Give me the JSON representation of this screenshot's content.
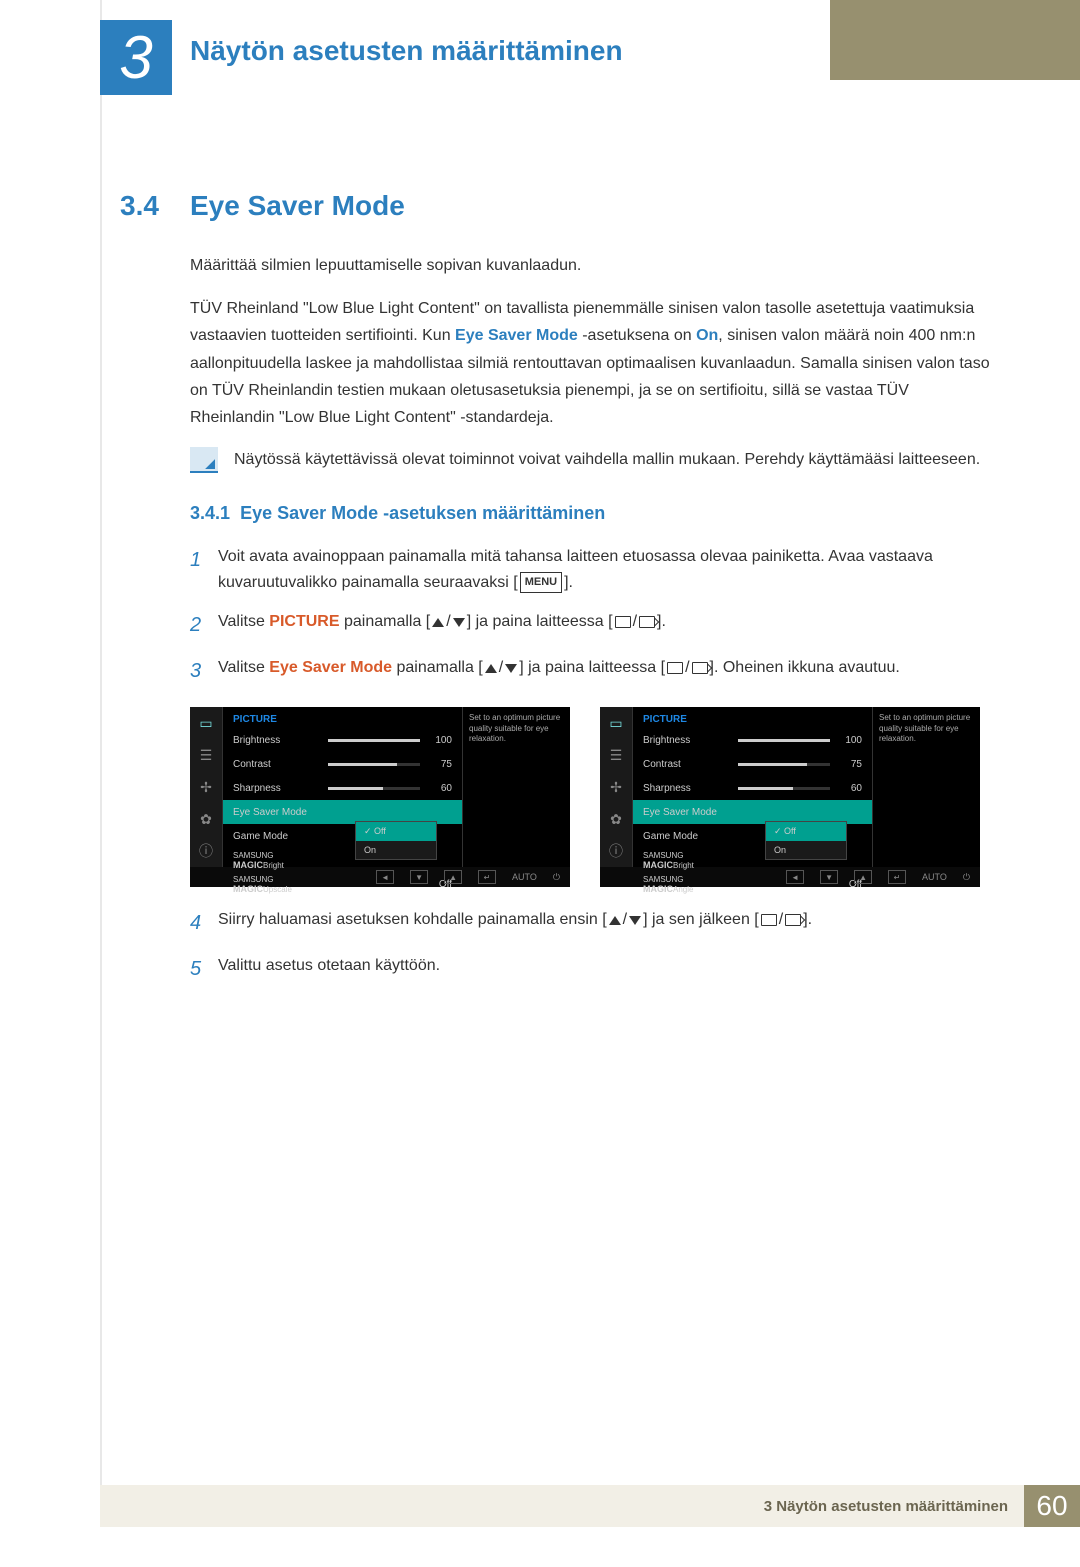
{
  "chapter": {
    "num": "3",
    "title": "Näytön asetusten määrittäminen"
  },
  "sec": {
    "num": "3.4",
    "title": "Eye Saver Mode"
  },
  "intro1": "Määrittää silmien lepuuttamiselle sopivan kuvanlaadun.",
  "intro2a": "TÜV Rheinland \"Low Blue Light Content\" on tavallista pienemmälle sinisen valon tasolle asetettuja vaatimuksia vastaavien tuotteiden sertifiointi. Kun ",
  "intro2b": "Eye Saver Mode",
  "intro2c": " -asetuksena on ",
  "intro2d": "On",
  "intro2e": ", sinisen valon määrä noin 400 nm:n aallonpituudella laskee ja mahdollistaa silmiä rentouttavan optimaalisen kuvanlaadun. Samalla sinisen valon taso on TÜV Rheinlandin testien mukaan oletusasetuksia pienempi, ja se on sertifioitu, sillä se vastaa TÜV Rheinlandin \"Low Blue Light Content\" -standardeja.",
  "note": "Näytössä käytettävissä olevat toiminnot voivat vaihdella mallin mukaan. Perehdy käyttämääsi laitteeseen.",
  "sub": {
    "num": "3.4.1",
    "title": "Eye Saver Mode -asetuksen määrittäminen"
  },
  "step1a": "Voit avata avainoppaan painamalla mitä tahansa laitteen etuosassa olevaa painiketta. Avaa vastaava kuvaruutuvalikko painamalla seuraavaksi [",
  "step1b": "].",
  "menu": "MENU",
  "step2a": "Valitse ",
  "step2b": "PICTURE",
  "step2c": " painamalla [",
  "step2d": "] ja paina laitteessa [",
  "step2e": "].",
  "step3a": "Valitse ",
  "step3b": "Eye Saver Mode",
  "step3c": " painamalla [",
  "step3d": "] ja paina laitteessa [",
  "step3e": "]. Oheinen ikkuna avautuu.",
  "step4a": "Siirry haluamasi asetuksen kohdalle painamalla ensin [",
  "step4b": "] ja sen jälkeen [",
  "step4c": "].",
  "step5": "Valittu asetus otetaan käyttöön.",
  "osd": {
    "hdr": "PICTURE",
    "tip": "Set to an optimum picture quality suitable for eye relaxation.",
    "rows": [
      {
        "l": "Brightness",
        "v": "100",
        "pct": 100
      },
      {
        "l": "Contrast",
        "v": "75",
        "pct": 75
      },
      {
        "l": "Sharpness",
        "v": "60",
        "pct": 60
      }
    ],
    "sel": "Eye Saver Mode",
    "game": "Game Mode",
    "magicb": "Bright",
    "magicu": "Upscale",
    "magica": "Angle",
    "off": "Off",
    "on": "On",
    "auto": "AUTO",
    "samsung": "SAMSUNG",
    "magic": "MAGIC"
  },
  "footer": {
    "chapter": "3 Näytön asetusten määrittäminen",
    "page": "60"
  }
}
